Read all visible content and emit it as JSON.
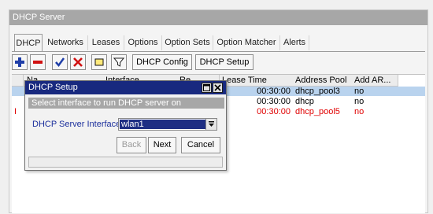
{
  "window": {
    "title": "DHCP Server"
  },
  "tabs": [
    "DHCP",
    "Networks",
    "Leases",
    "Options",
    "Option Sets",
    "Option Matcher",
    "Alerts"
  ],
  "toolbar": {
    "dhcp_config": "DHCP Config",
    "dhcp_setup": "DHCP Setup"
  },
  "table": {
    "headers": [
      "Na",
      "Interface",
      "Re",
      "Lease Time",
      "Address Pool",
      "Add AR..."
    ],
    "rows": [
      {
        "flag": "",
        "lease_time": "00:30:00",
        "pool": "dhcp_pool3",
        "add_arp": "no",
        "selected": true,
        "disabled": false
      },
      {
        "flag": "",
        "lease_time": "00:30:00",
        "pool": "dhcp",
        "add_arp": "no",
        "selected": false,
        "disabled": false
      },
      {
        "flag": "I",
        "lease_time": "00:30:00",
        "pool": "dhcp_pool5",
        "add_arp": "no",
        "selected": false,
        "disabled": true
      }
    ]
  },
  "dialog": {
    "title": "DHCP Setup",
    "hint": "Select interface to run DHCP server on",
    "field_label": "DHCP Server Interface:",
    "interface_value": "wlan1",
    "back_label": "Back",
    "next_label": "Next",
    "cancel_label": "Cancel"
  },
  "colors": {
    "titlebar": "#a7a7a7",
    "dialog_titlebar": "#18297f",
    "selected_row": "#b9d3ee",
    "disabled_row_text": "#e00000",
    "field_label": "#1b2f9c"
  }
}
